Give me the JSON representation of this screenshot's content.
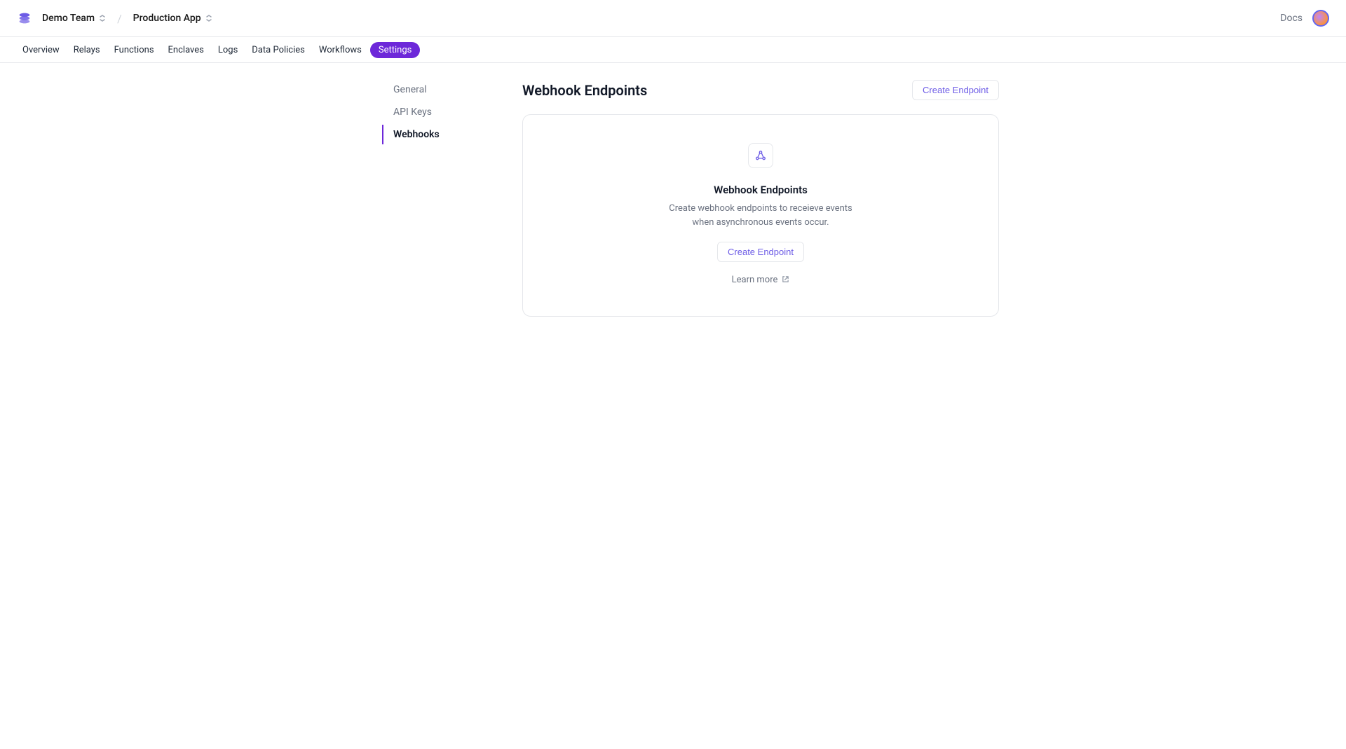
{
  "topbar": {
    "team": "Demo Team",
    "app": "Production App",
    "docs": "Docs"
  },
  "nav": {
    "items": [
      {
        "label": "Overview"
      },
      {
        "label": "Relays"
      },
      {
        "label": "Functions"
      },
      {
        "label": "Enclaves"
      },
      {
        "label": "Logs"
      },
      {
        "label": "Data Policies"
      },
      {
        "label": "Workflows"
      },
      {
        "label": "Settings",
        "active": true
      }
    ]
  },
  "sidebar": {
    "items": [
      {
        "label": "General"
      },
      {
        "label": "API Keys"
      },
      {
        "label": "Webhooks",
        "active": true
      }
    ]
  },
  "page": {
    "title": "Webhook Endpoints",
    "create_button": "Create Endpoint",
    "empty_title": "Webhook Endpoints",
    "empty_desc": "Create webhook endpoints to receieve events when asynchronous events occur.",
    "empty_create": "Create Endpoint",
    "learn_more": "Learn more"
  }
}
